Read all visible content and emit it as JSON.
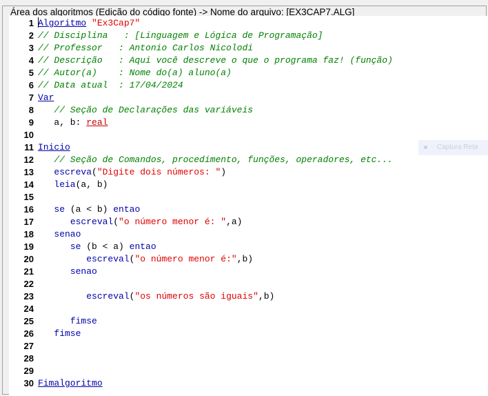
{
  "panel": {
    "title": "Área dos algoritmos (Edição do código fonte) -> Nome do arquivo: [EX3CAP7.ALG]"
  },
  "overlay": {
    "capture_label": "Captura Reta"
  },
  "colors": {
    "keyword": "#0000aa",
    "comment": "#008000",
    "string": "#e00000",
    "type": "#cc0000"
  },
  "lines": [
    {
      "n": "1",
      "tokens": [
        {
          "c": "kwu",
          "t": "Algoritmo"
        },
        {
          "c": "plain",
          "t": " "
        },
        {
          "c": "str",
          "t": "\"Ex3Cap7\""
        }
      ]
    },
    {
      "n": "2",
      "tokens": [
        {
          "c": "cm",
          "t": "// Disciplina   : [Linguagem e Lógica de Programação]"
        }
      ]
    },
    {
      "n": "3",
      "tokens": [
        {
          "c": "cm",
          "t": "// Professor   : Antonio Carlos Nicolodi"
        }
      ]
    },
    {
      "n": "4",
      "tokens": [
        {
          "c": "cm",
          "t": "// Descrição   : Aqui você descreve o que o programa faz! (função)"
        }
      ]
    },
    {
      "n": "5",
      "tokens": [
        {
          "c": "cm",
          "t": "// Autor(a)    : Nome do(a) aluno(a)"
        }
      ]
    },
    {
      "n": "6",
      "tokens": [
        {
          "c": "cm",
          "t": "// Data atual  : 17/04/2024"
        }
      ]
    },
    {
      "n": "7",
      "tokens": [
        {
          "c": "kwu",
          "t": "Var"
        }
      ]
    },
    {
      "n": "8",
      "tokens": [
        {
          "c": "plain",
          "t": "   "
        },
        {
          "c": "cm",
          "t": "// Seção de Declarações das variáveis"
        }
      ]
    },
    {
      "n": "9",
      "tokens": [
        {
          "c": "plain",
          "t": "   a, b: "
        },
        {
          "c": "type",
          "t": "real"
        }
      ]
    },
    {
      "n": "10",
      "tokens": []
    },
    {
      "n": "11",
      "tokens": [
        {
          "c": "kwu",
          "t": "Inicio"
        }
      ]
    },
    {
      "n": "12",
      "tokens": [
        {
          "c": "plain",
          "t": "   "
        },
        {
          "c": "cm",
          "t": "// Seção de Comandos, procedimento, funções, operadores, etc..."
        }
      ]
    },
    {
      "n": "13",
      "tokens": [
        {
          "c": "plain",
          "t": "   "
        },
        {
          "c": "kw",
          "t": "escreva"
        },
        {
          "c": "plain",
          "t": "("
        },
        {
          "c": "str",
          "t": "\"Digite dois números: \""
        },
        {
          "c": "plain",
          "t": ")"
        }
      ]
    },
    {
      "n": "14",
      "tokens": [
        {
          "c": "plain",
          "t": "   "
        },
        {
          "c": "kw",
          "t": "leia"
        },
        {
          "c": "plain",
          "t": "(a, b)"
        }
      ]
    },
    {
      "n": "15",
      "tokens": []
    },
    {
      "n": "16",
      "tokens": [
        {
          "c": "plain",
          "t": "   "
        },
        {
          "c": "kw",
          "t": "se"
        },
        {
          "c": "plain",
          "t": " (a < b) "
        },
        {
          "c": "kw",
          "t": "entao"
        }
      ]
    },
    {
      "n": "17",
      "tokens": [
        {
          "c": "plain",
          "t": "      "
        },
        {
          "c": "kw",
          "t": "escreval"
        },
        {
          "c": "plain",
          "t": "("
        },
        {
          "c": "str",
          "t": "\"o número menor é: \""
        },
        {
          "c": "plain",
          "t": ",a)"
        }
      ]
    },
    {
      "n": "18",
      "tokens": [
        {
          "c": "plain",
          "t": "   "
        },
        {
          "c": "kw",
          "t": "senao"
        }
      ]
    },
    {
      "n": "19",
      "tokens": [
        {
          "c": "plain",
          "t": "      "
        },
        {
          "c": "kw",
          "t": "se"
        },
        {
          "c": "plain",
          "t": " (b < a) "
        },
        {
          "c": "kw",
          "t": "entao"
        }
      ]
    },
    {
      "n": "20",
      "tokens": [
        {
          "c": "plain",
          "t": "         "
        },
        {
          "c": "kw",
          "t": "escreval"
        },
        {
          "c": "plain",
          "t": "("
        },
        {
          "c": "str",
          "t": "\"o número menor é:\""
        },
        {
          "c": "plain",
          "t": ",b)"
        }
      ]
    },
    {
      "n": "21",
      "tokens": [
        {
          "c": "plain",
          "t": "      "
        },
        {
          "c": "kw",
          "t": "senao"
        }
      ]
    },
    {
      "n": "22",
      "tokens": []
    },
    {
      "n": "23",
      "tokens": [
        {
          "c": "plain",
          "t": "         "
        },
        {
          "c": "kw",
          "t": "escreval"
        },
        {
          "c": "plain",
          "t": "("
        },
        {
          "c": "str",
          "t": "\"os números são iguais\""
        },
        {
          "c": "plain",
          "t": ",b)"
        }
      ]
    },
    {
      "n": "24",
      "tokens": []
    },
    {
      "n": "25",
      "tokens": [
        {
          "c": "plain",
          "t": "      "
        },
        {
          "c": "kw",
          "t": "fimse"
        }
      ]
    },
    {
      "n": "26",
      "tokens": [
        {
          "c": "plain",
          "t": "   "
        },
        {
          "c": "kw",
          "t": "fimse"
        }
      ]
    },
    {
      "n": "27",
      "tokens": []
    },
    {
      "n": "28",
      "tokens": []
    },
    {
      "n": "29",
      "tokens": []
    },
    {
      "n": "30",
      "tokens": [
        {
          "c": "kwu",
          "t": "Fimalgoritmo"
        }
      ]
    }
  ]
}
